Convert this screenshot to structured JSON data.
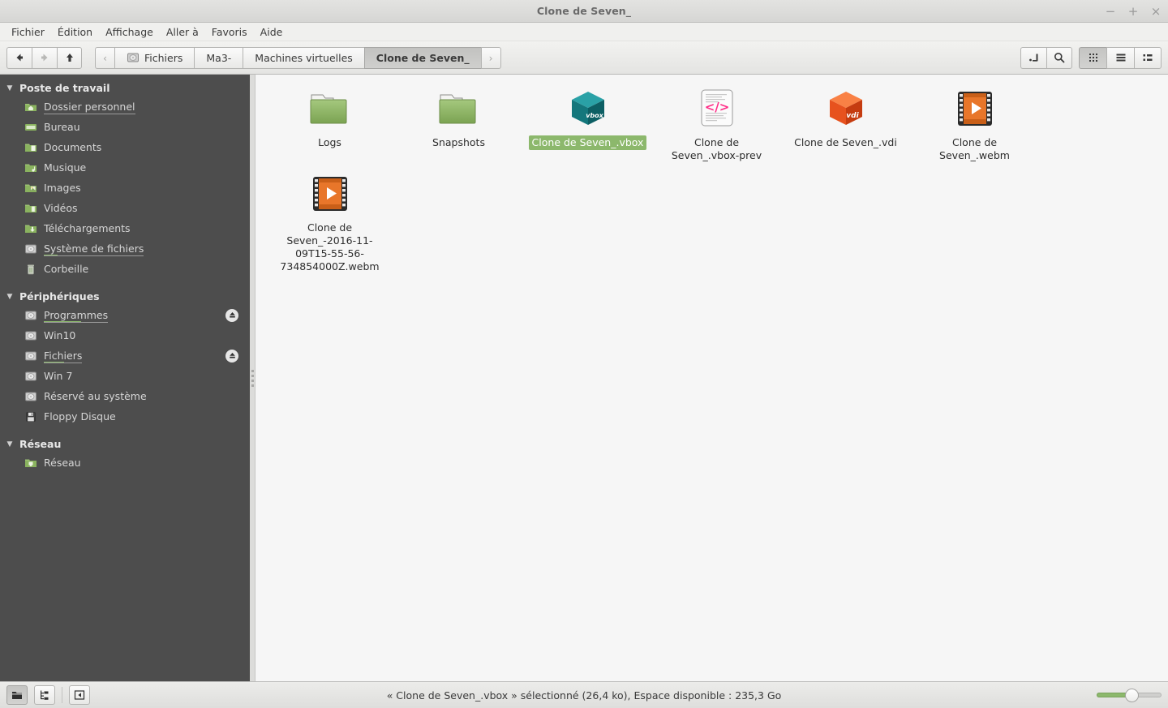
{
  "window": {
    "title": "Clone de Seven_",
    "controls": [
      {
        "name": "minimize-button",
        "glyph": "−"
      },
      {
        "name": "maximize-button",
        "glyph": "+"
      },
      {
        "name": "close-button",
        "glyph": "×"
      }
    ]
  },
  "menubar": {
    "items": [
      "Fichier",
      "Édition",
      "Affichage",
      "Aller à",
      "Favoris",
      "Aide"
    ]
  },
  "toolbar": {
    "nav": [
      {
        "name": "back-button",
        "glyph": "◀",
        "enabled": true
      },
      {
        "name": "forward-button",
        "glyph": "▶",
        "enabled": false
      },
      {
        "name": "up-button",
        "glyph": "▲",
        "enabled": true
      }
    ],
    "breadcrumb": {
      "prev_glyph": "‹",
      "next_glyph": "›",
      "items": [
        {
          "label": "Fichiers",
          "icon": "drive-icon",
          "active": false
        },
        {
          "label": "Ma3-",
          "icon": null,
          "active": false
        },
        {
          "label": "Machines virtuelles",
          "icon": null,
          "active": false
        },
        {
          "label": "Clone de Seven_",
          "icon": null,
          "active": true
        }
      ]
    },
    "right_buttons": [
      {
        "name": "toggle-location-entry-button",
        "icon": "location-entry-icon",
        "pressed": false
      },
      {
        "name": "search-button",
        "icon": "search-icon",
        "pressed": false
      }
    ],
    "view_buttons": [
      {
        "name": "icon-view-button",
        "icon": "grid-view-icon",
        "pressed": true
      },
      {
        "name": "list-view-button",
        "icon": "list-view-icon",
        "pressed": false
      },
      {
        "name": "compact-view-button",
        "icon": "compact-view-icon",
        "pressed": false
      }
    ]
  },
  "sidebar": {
    "groups": [
      {
        "title": "Poste de travail",
        "name": "sidebar-group-poste-de-travail",
        "expanded": true,
        "items": [
          {
            "label": "Dossier personnel",
            "icon": "home-folder-icon",
            "underlined": true,
            "eject": false,
            "usage": 0
          },
          {
            "label": "Bureau",
            "icon": "desktop-folder-icon",
            "underlined": false,
            "eject": false,
            "usage": 0
          },
          {
            "label": "Documents",
            "icon": "documents-folder-icon",
            "underlined": false,
            "eject": false,
            "usage": 0
          },
          {
            "label": "Musique",
            "icon": "music-folder-icon",
            "underlined": false,
            "eject": false,
            "usage": 0
          },
          {
            "label": "Images",
            "icon": "pictures-folder-icon",
            "underlined": false,
            "eject": false,
            "usage": 0
          },
          {
            "label": "Vidéos",
            "icon": "videos-folder-icon",
            "underlined": false,
            "eject": false,
            "usage": 0
          },
          {
            "label": "Téléchargements",
            "icon": "downloads-folder-icon",
            "underlined": false,
            "eject": false,
            "usage": 0
          },
          {
            "label": "Système de fichiers",
            "icon": "drive-icon",
            "underlined": true,
            "eject": false,
            "usage": 5
          },
          {
            "label": "Corbeille",
            "icon": "trash-icon",
            "underlined": false,
            "eject": false,
            "usage": 0
          }
        ]
      },
      {
        "title": "Périphériques",
        "name": "sidebar-group-peripheriques",
        "expanded": true,
        "items": [
          {
            "label": "Programmes",
            "icon": "drive-icon",
            "underlined": true,
            "eject": true,
            "usage": 30
          },
          {
            "label": "Win10",
            "icon": "drive-icon",
            "underlined": false,
            "eject": false,
            "usage": 0
          },
          {
            "label": "Fichiers",
            "icon": "drive-icon",
            "underlined": true,
            "eject": true,
            "usage": 30
          },
          {
            "label": "Win 7",
            "icon": "drive-icon",
            "underlined": false,
            "eject": false,
            "usage": 0
          },
          {
            "label": "Réservé au système",
            "icon": "drive-icon",
            "underlined": false,
            "eject": false,
            "usage": 0
          },
          {
            "label": "Floppy Disque",
            "icon": "floppy-icon",
            "underlined": false,
            "eject": false,
            "usage": 0
          }
        ]
      },
      {
        "title": "Réseau",
        "name": "sidebar-group-reseau",
        "expanded": true,
        "items": [
          {
            "label": "Réseau",
            "icon": "network-folder-icon",
            "underlined": false,
            "eject": false,
            "usage": 0
          }
        ]
      }
    ]
  },
  "files": [
    {
      "label": "Logs",
      "icon": "folder-icon",
      "selected": false
    },
    {
      "label": "Snapshots",
      "icon": "folder-icon",
      "selected": false
    },
    {
      "label": "Clone de Seven_.vbox",
      "icon": "vbox-cube-icon",
      "selected": true
    },
    {
      "label": "Clone de Seven_.vbox-prev",
      "icon": "xml-document-icon",
      "selected": false
    },
    {
      "label": "Clone de Seven_.vdi",
      "icon": "vdi-cube-icon",
      "selected": false
    },
    {
      "label": "Clone de Seven_.webm",
      "icon": "video-film-icon",
      "selected": false
    },
    {
      "label": "Clone de Seven_-2016-11-09T15-55-56-734854000Z.webm",
      "icon": "video-film-icon",
      "selected": false
    }
  ],
  "statusbar": {
    "buttons": [
      {
        "name": "shortcuts-pane-button",
        "icon": "places-icon",
        "pressed": true
      },
      {
        "name": "tree-pane-button",
        "icon": "tree-icon",
        "pressed": false
      },
      {
        "name": "toggle-sidebar-button",
        "icon": "sidebar-toggle-icon",
        "pressed": false
      }
    ],
    "text": "« Clone de Seven_.vbox » sélectionné (26,4 ko), Espace disponible : 235,3 Go",
    "zoom": {
      "name": "zoom-slider",
      "value": 55
    }
  },
  "colors": {
    "sidebar_bg": "#4d4d4d",
    "selection_green": "#8cb86c",
    "folder_green": "#8ab35f",
    "vbox_teal": "#157b80",
    "vdi_orange": "#e8521f",
    "pane_bg": "#f6f6f6"
  }
}
